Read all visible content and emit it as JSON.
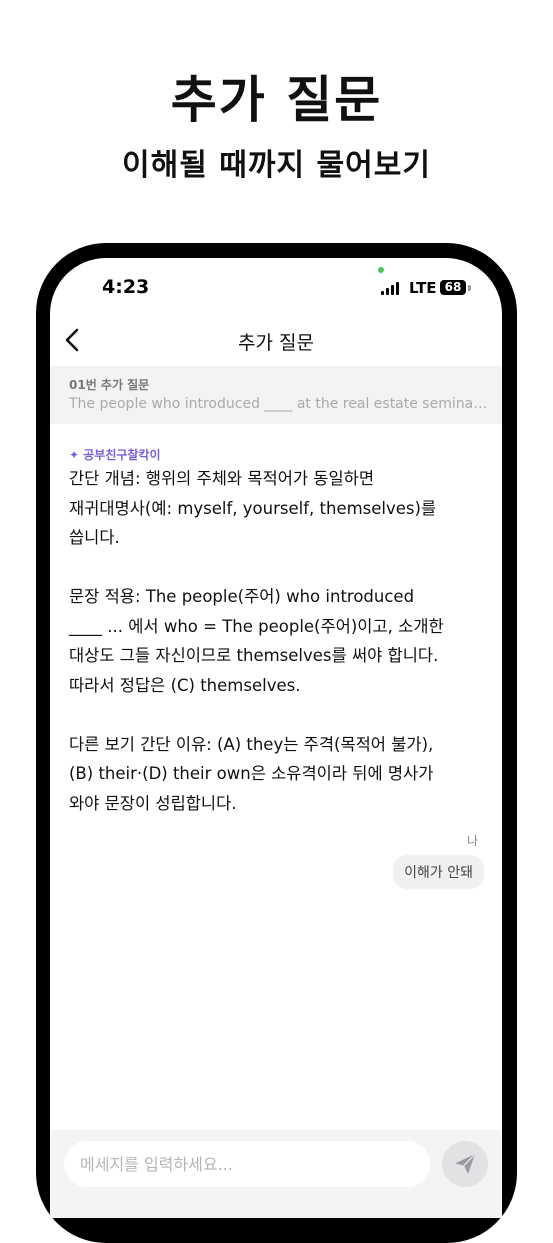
{
  "promo": {
    "title": "추가 질문",
    "subtitle": "이해될 때까지 물어보기"
  },
  "status_bar": {
    "time": "4:23",
    "network": "LTE",
    "battery": "68"
  },
  "nav": {
    "title": "추가 질문"
  },
  "question": {
    "label": "01번 추가 질문",
    "text": "The people who introduced ____ at the real estate seminar w..."
  },
  "bot": {
    "name": "✦ 공부친구찰칵이",
    "lines": [
      "간단 개념: 행위의 주체와 목적어가 동일하면",
      "재귀대명사(예: myself, yourself, themselves)를",
      "씁니다.",
      "문장 적용: The people(주어) who introduced",
      "____ ... 에서 who = The people(주어)이고, 소개한",
      "대상도 그들 자신이므로 themselves를 써야 합니다.",
      "따라서 정답은 (C) themselves.",
      "다른 보기 간단 이유: (A) they는 주격(목적어 불가),",
      "(B) their·(D) their own은 소유격이라 뒤에 명사가",
      "와야 문장이 성립합니다."
    ]
  },
  "user": {
    "label": "나",
    "message": "이해가 안돼"
  },
  "composer": {
    "placeholder": "메세지를 입력하세요..."
  },
  "colors": {
    "accent": "#7b5fd6",
    "question_bg": "#f3f3f5",
    "bubble_bg": "#f0f0f2"
  },
  "icons": {
    "back": "chevron-left-icon",
    "send": "send-icon"
  }
}
